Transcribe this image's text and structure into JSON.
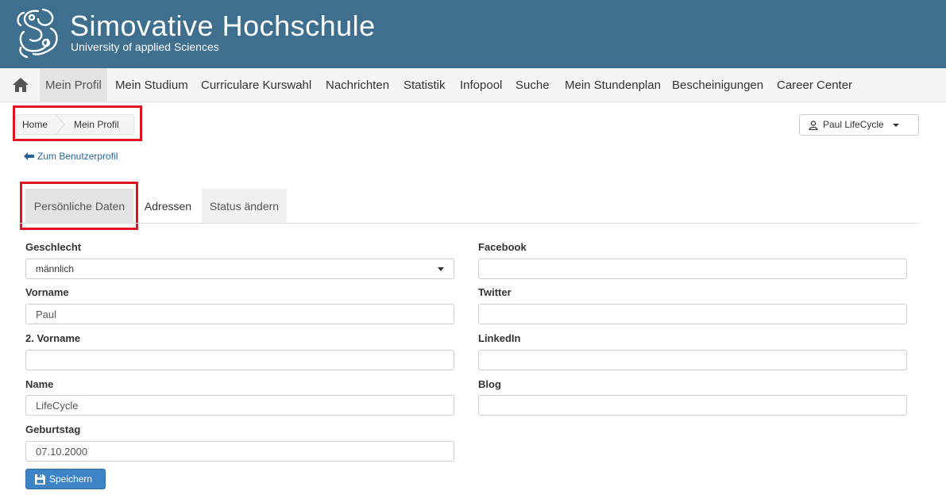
{
  "header": {
    "title": "Simovative  Hochschule",
    "subtitle": "University of applied Sciences",
    "background": "#3e6f8e"
  },
  "nav": {
    "home_icon": "home-icon",
    "items": [
      {
        "label": "Mein Profil",
        "active": true
      },
      {
        "label": "Mein Studium"
      },
      {
        "label": "Curriculare Kurswahl"
      },
      {
        "label": "Nachrichten"
      },
      {
        "label": "Statistik"
      },
      {
        "label": "Infopool"
      },
      {
        "label": "Suche"
      },
      {
        "label": "Mein Stundenplan"
      },
      {
        "label": "Bescheinigungen"
      },
      {
        "label": "Career Center"
      }
    ]
  },
  "breadcrumb": {
    "home": "Home",
    "current": "Mein Profil"
  },
  "user_menu": {
    "label": "Paul LifeCycle",
    "icon": "user-icon"
  },
  "back_link": {
    "label": "Zum Benutzerprofil",
    "icon": "arrow-left-icon"
  },
  "tabs": [
    {
      "label": "Persönliche Daten",
      "active": true
    },
    {
      "label": "Adressen"
    },
    {
      "label": "Status ändern"
    }
  ],
  "form": {
    "left": {
      "gender": {
        "label": "Geschlecht",
        "value": "männlich"
      },
      "firstname": {
        "label": "Vorname",
        "value": "Paul"
      },
      "secondname": {
        "label": "2. Vorname",
        "value": ""
      },
      "lastname": {
        "label": "Name",
        "value": "LifeCycle"
      },
      "birthday": {
        "label": "Geburtstag",
        "value": "07.10.2000"
      }
    },
    "right": {
      "facebook": {
        "label": "Facebook",
        "value": ""
      },
      "twitter": {
        "label": "Twitter",
        "value": ""
      },
      "linkedin": {
        "label": "LinkedIn",
        "value": ""
      },
      "blog": {
        "label": "Blog",
        "value": ""
      }
    },
    "save_label": "Speichern",
    "save_icon": "floppy-disk-icon"
  },
  "colors": {
    "accent": "#3d84c6",
    "highlight_border": "#e0151f",
    "link": "#2a6496"
  }
}
